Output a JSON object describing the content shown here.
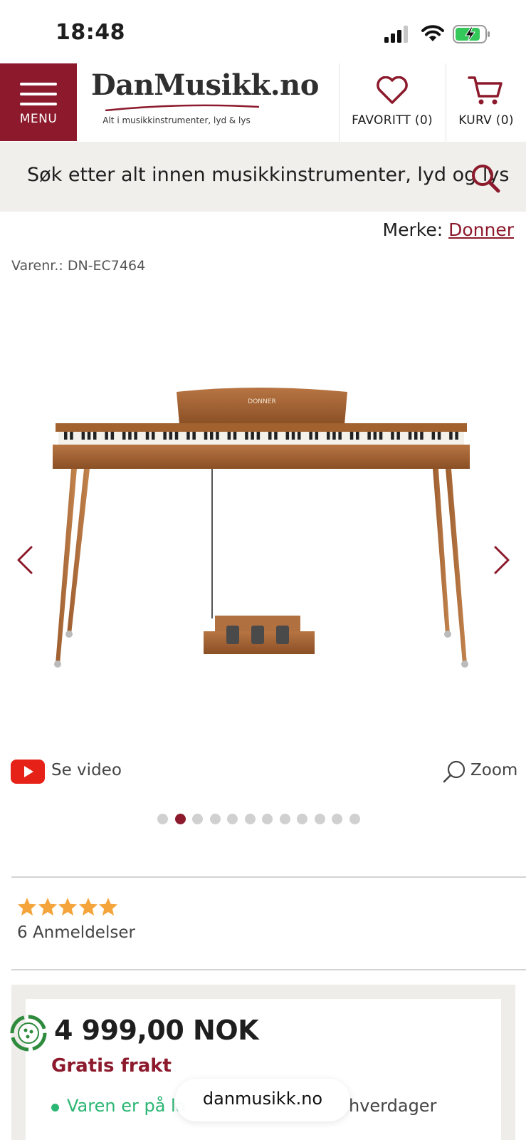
{
  "status_bar": {
    "time": "18:48"
  },
  "header": {
    "menu_label": "MENU",
    "logo_text": "DanMusikk.no",
    "logo_tagline": "Alt i musikkinstrumenter, lyd & lys",
    "favorites_label": "FAVORITT (0)",
    "cart_label": "KURV (0)"
  },
  "search": {
    "placeholder": "Søk etter alt innen musikkinstrumenter, lyd og lys"
  },
  "product": {
    "brand_prefix": "Merke:",
    "brand_name": "Donner",
    "sku": "Varenr.: DN-EC7464",
    "image_logo_text": "DONNER",
    "video_label": "Se video",
    "zoom_label": "Zoom",
    "gallery_count": 12,
    "gallery_active_index": 1,
    "rating": 5,
    "reviews_label": "6 Anmeldelser",
    "price": "4 999,00 NOK",
    "shipping": "Gratis frakt",
    "stock_text": "Varen er på la",
    "stock_text_suffix": "hverdager"
  },
  "browser": {
    "url": "danmusikk.no"
  },
  "colors": {
    "brand": "#8c1a2c",
    "stock_green": "#2bb673",
    "star": "#f4a43a",
    "search_bg": "#f1efec"
  }
}
